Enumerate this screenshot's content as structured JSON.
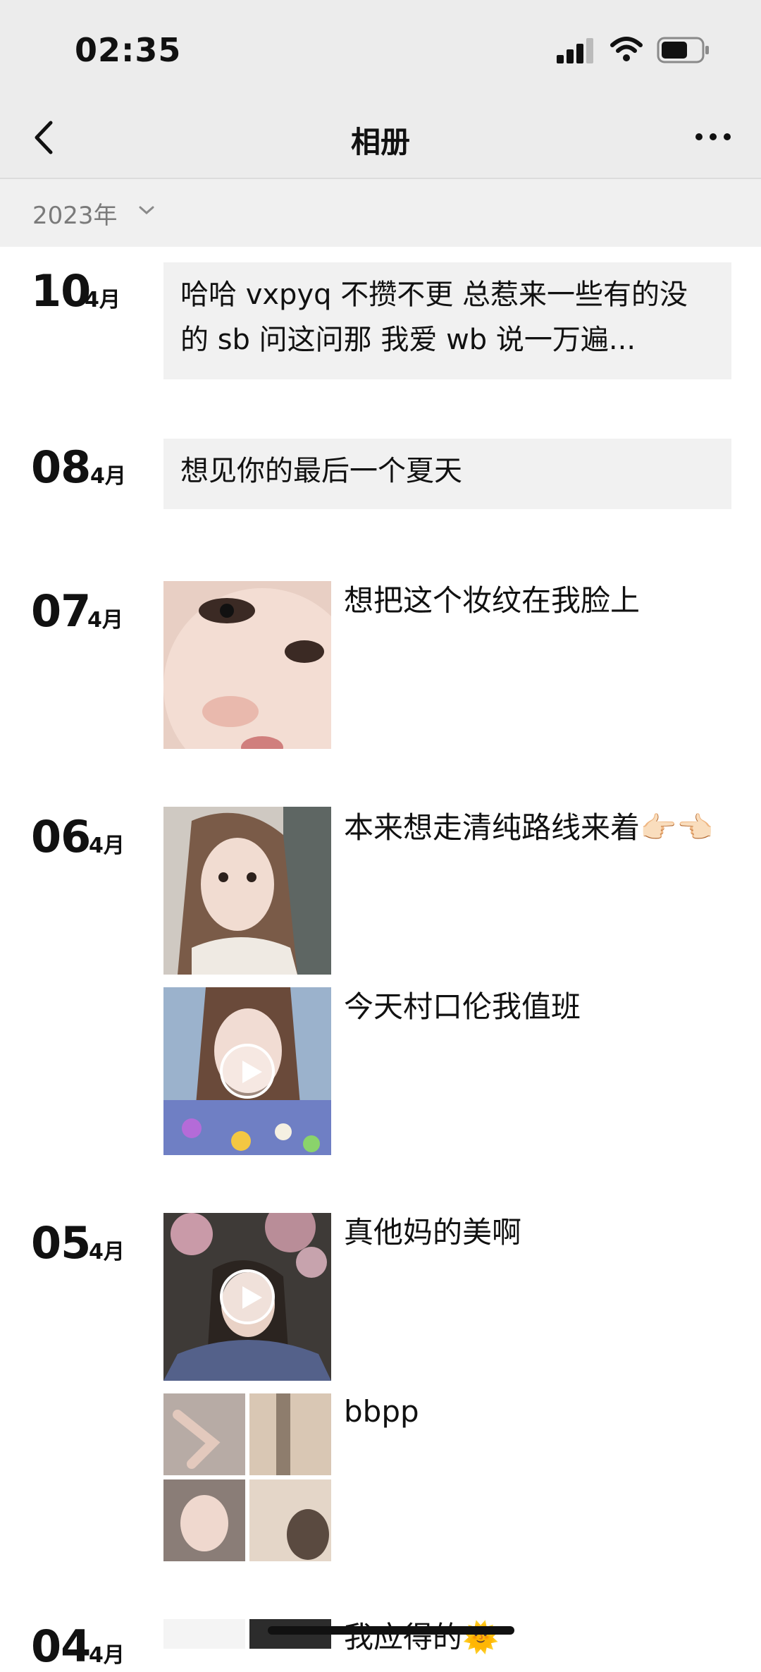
{
  "status_bar": {
    "time": "02:35"
  },
  "nav": {
    "title": "相册"
  },
  "year_filter": {
    "label": "2023年"
  },
  "entries": [
    {
      "day": "10",
      "month": "4月",
      "text": "哈哈 vxpyq 不攒不更 总惹来一些有的没的 sb 问这问那 我爱 wb 说一万遍..."
    },
    {
      "day": "08",
      "month": "4月",
      "text": "想见你的最后一个夏天"
    },
    {
      "day": "07",
      "month": "4月",
      "caption": "想把这个妆纹在我脸上"
    },
    {
      "day": "06",
      "month": "4月",
      "caption_1": "本来想走清纯路线来着👉🏻👈🏻",
      "caption_2": "今天村口伦我值班"
    },
    {
      "day": "05",
      "month": "4月",
      "caption_1": "真他妈的美啊",
      "caption_2": "bbpp"
    },
    {
      "day": "04",
      "month": "4月",
      "caption": "我应得的🌞"
    }
  ]
}
